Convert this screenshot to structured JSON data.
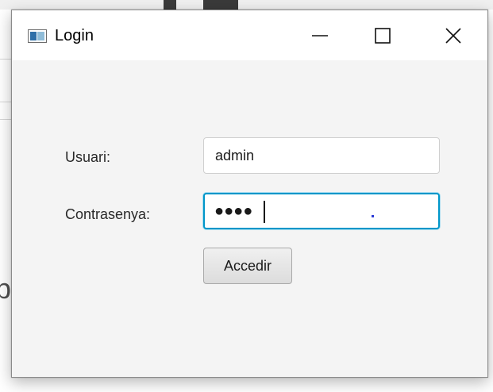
{
  "window": {
    "title": "Login",
    "controls": {
      "minimize_icon": "minimize-icon",
      "maximize_icon": "maximize-icon",
      "close_icon": "close-icon"
    }
  },
  "form": {
    "user_label": "Usuari:",
    "user_value": "admin",
    "password_label": "Contrasenya:",
    "password_masked": "●●●●",
    "submit_label": "Accedir"
  },
  "background": {
    "partial_letter": "p"
  },
  "colors": {
    "focus_ring": "#0096c9",
    "window_bg": "#f4f4f4",
    "titlebar_bg": "#ffffff"
  }
}
